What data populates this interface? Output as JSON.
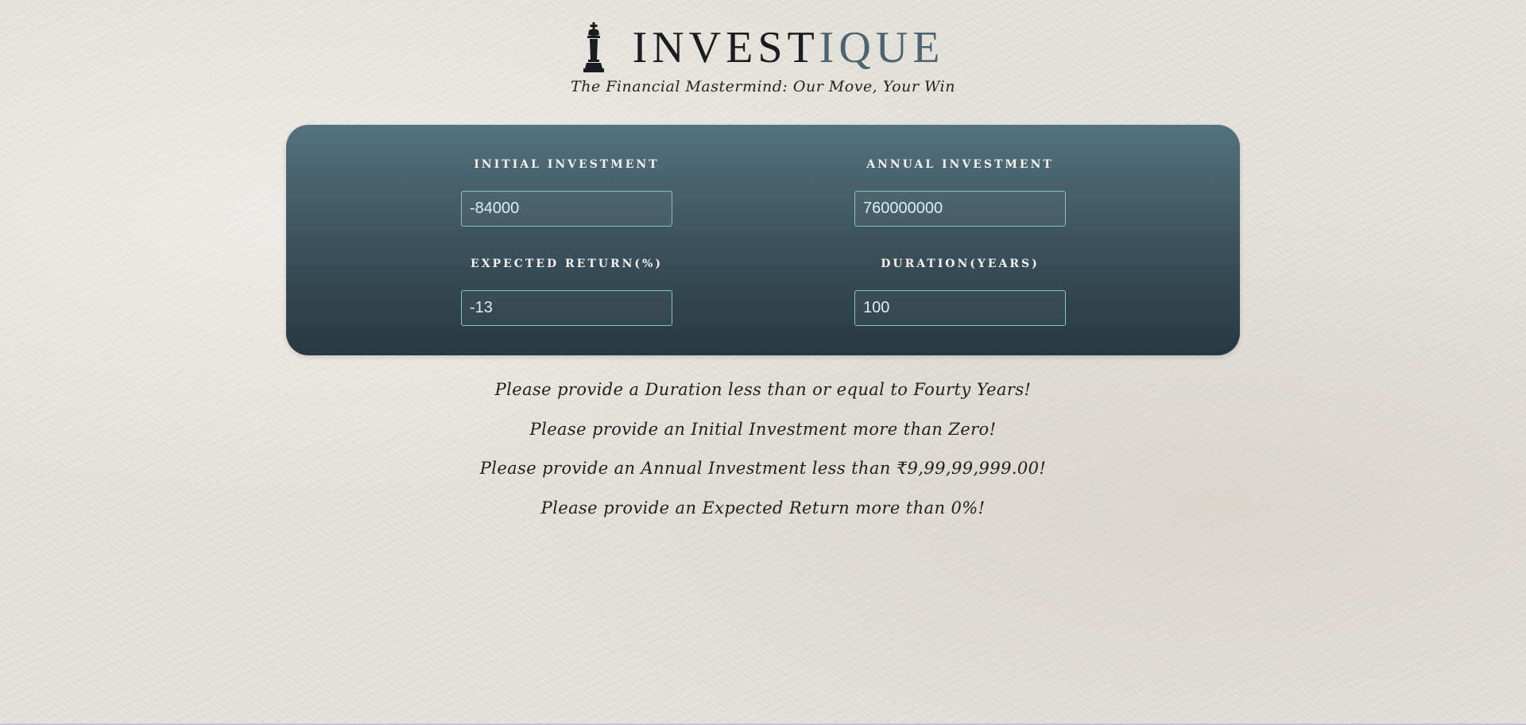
{
  "header": {
    "brand_primary": "INVEST",
    "brand_accent": "IQUE",
    "tagline": "The Financial Mastermind: Our Move, Your Win",
    "logo_icon": "chess-king-icon"
  },
  "form": {
    "initial_investment": {
      "label": "INITIAL INVESTMENT",
      "value": "-84000"
    },
    "annual_investment": {
      "label": "ANNUAL INVESTMENT",
      "value": "760000000"
    },
    "expected_return": {
      "label": "EXPECTED RETURN(%)",
      "value": "-13"
    },
    "duration": {
      "label": "DURATION(YEARS)",
      "value": "100"
    }
  },
  "errors": [
    "Please provide a Duration less than or equal to Fourty Years!",
    "Please provide an Initial Investment more than Zero!",
    "Please provide an Annual Investment less than ₹9,99,99,999.00!",
    "Please provide an Expected Return more than 0%!"
  ],
  "colors": {
    "background": "#e6e2db",
    "panel_top": "#54737f",
    "panel_bottom": "#283840",
    "input_border": "#7fc6c4",
    "brand_accent": "#4b6470"
  }
}
